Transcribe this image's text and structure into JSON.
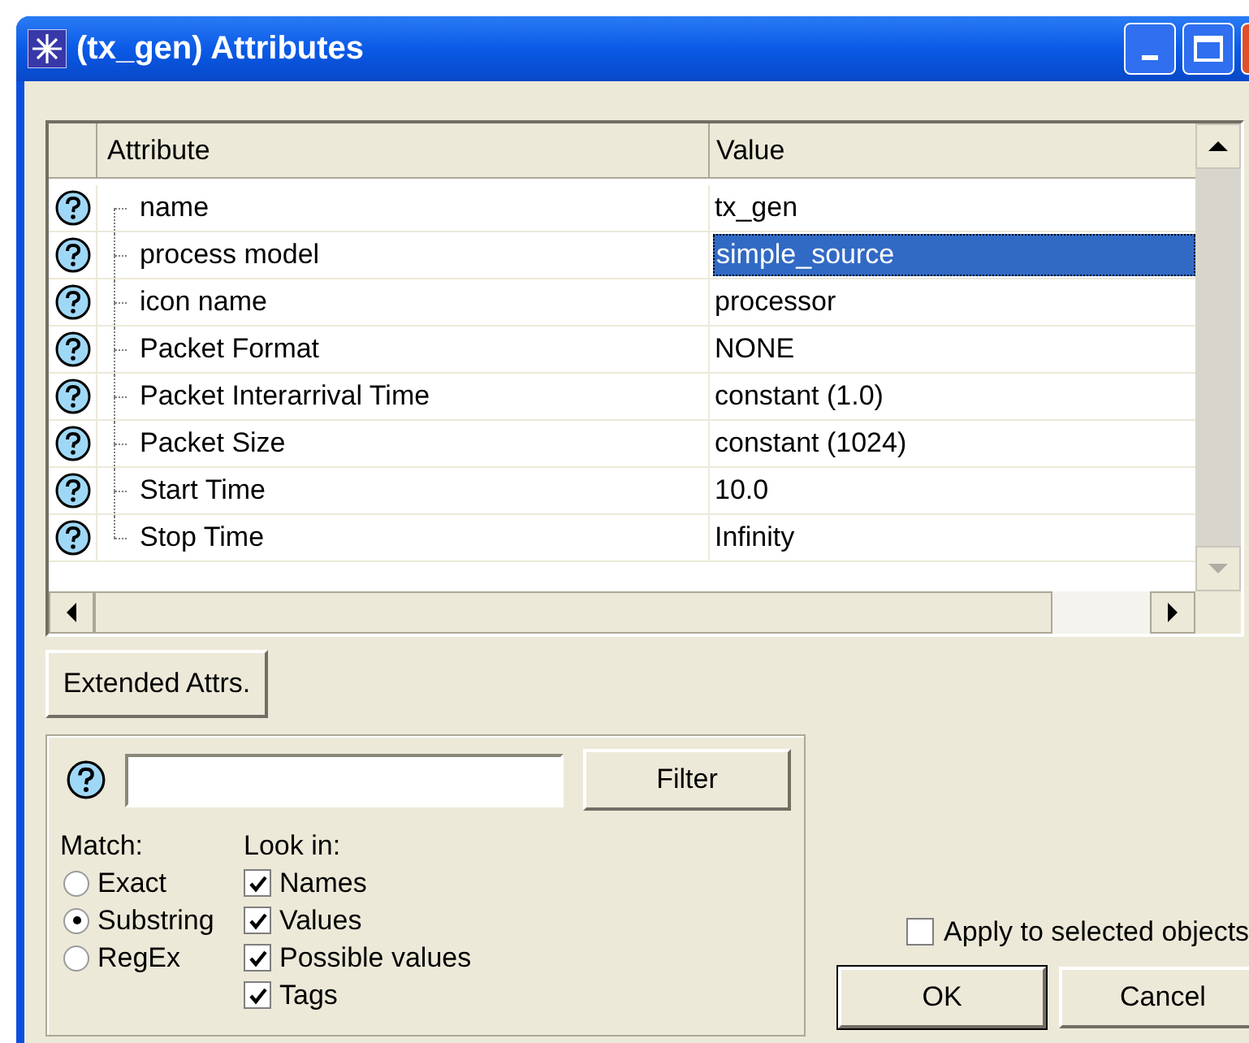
{
  "window": {
    "title": "(tx_gen) Attributes"
  },
  "table": {
    "columns": [
      "Attribute",
      "Value"
    ],
    "rows": [
      {
        "attribute": "name",
        "value": "tx_gen",
        "selected": false
      },
      {
        "attribute": "process model",
        "value": "simple_source",
        "selected": true
      },
      {
        "attribute": "icon name",
        "value": "processor",
        "selected": false
      },
      {
        "attribute": "Packet Format",
        "value": "NONE",
        "selected": false
      },
      {
        "attribute": "Packet Interarrival Time",
        "value": "constant (1.0)",
        "selected": false
      },
      {
        "attribute": "Packet Size",
        "value": "constant (1024)",
        "selected": false
      },
      {
        "attribute": "Start Time",
        "value": "10.0",
        "selected": false
      },
      {
        "attribute": "Stop Time",
        "value": "Infinity",
        "selected": false
      }
    ]
  },
  "extended_button": "Extended Attrs.",
  "filter": {
    "button": "Filter",
    "match_label": "Match:",
    "match_options": [
      {
        "label": "Exact",
        "selected": false
      },
      {
        "label": "Substring",
        "selected": true
      },
      {
        "label": "RegEx",
        "selected": false
      }
    ],
    "look_in_label": "Look in:",
    "look_in": [
      {
        "label": "Names",
        "checked": true
      },
      {
        "label": "Values",
        "checked": true
      },
      {
        "label": "Possible values",
        "checked": true
      },
      {
        "label": "Tags",
        "checked": true
      }
    ]
  },
  "apply_to_selected": {
    "label": "Apply to selected objects",
    "checked": false
  },
  "buttons": [
    "OK",
    "Cancel"
  ]
}
